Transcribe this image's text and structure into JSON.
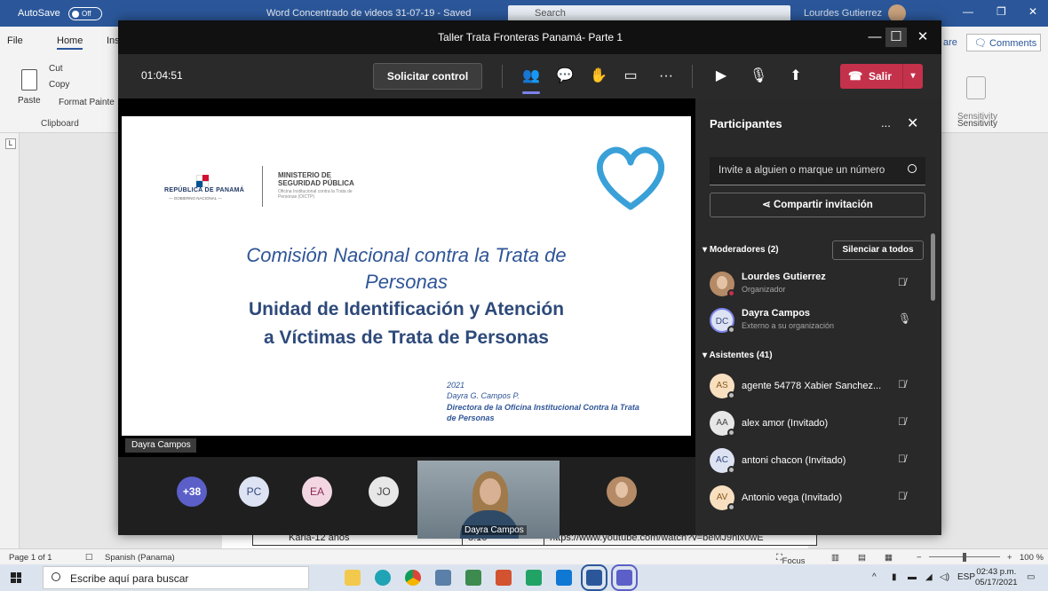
{
  "word": {
    "autosave_label": "AutoSave",
    "autosave_state": "Off",
    "doc_title": "Word Concentrado de videos 31-07-19 - Saved",
    "search_placeholder": "Search",
    "user_name": "Lourdes Gutierrez",
    "tabs": {
      "file": "File",
      "home": "Home",
      "insert_fragment": "Ins"
    },
    "clipboard": {
      "paste": "Paste",
      "cut": "Cut",
      "copy": "Copy",
      "format_painter": "Format Painte",
      "group": "Clipboard"
    },
    "share_fragment": "are",
    "comments": "Comments",
    "sensitivity": "Sensitivity",
    "sensitivity_group": "Sensitivity",
    "ruler_marker": "L",
    "table_row": {
      "col1": "Karla-12 años",
      "col2": "8:16",
      "col3": "https://www.youtube.com/watch?v=beMJ9hix0wE"
    },
    "status": {
      "page": "Page 1 of 1",
      "language": "Spanish (Panama)",
      "focus": "Focus",
      "zoom": "100 %"
    }
  },
  "taskbar": {
    "search_placeholder": "Escribe aquí para buscar",
    "lang": "ESP",
    "time": "02:43 p.m.",
    "date": "05/17/2021"
  },
  "teams": {
    "window_title": "Taller Trata Fronteras Panamá- Parte 1",
    "timer": "01:04:51",
    "request_control": "Solicitar control",
    "leave": "Salir",
    "presenter_name": "Dayra Campos",
    "slide": {
      "republica": "REPÚBLICA DE PANAMÁ",
      "republica_sub": "— GOBIERNO NACIONAL —",
      "ministerio_1": "MINISTERIO DE",
      "ministerio_2": "SEGURIDAD PÚBLICA",
      "ministerio_sub": "Oficina Institucional contra la Trata de Personas (OICTP)",
      "title_1": "Comisión Nacional contra la Trata de",
      "title_2": "Personas",
      "title_3": "Unidad de Identificación y Atención",
      "title_4": "a Víctimas de Trata de Personas",
      "year": "2021",
      "author": "Dayra G. Campos P.",
      "role_1": "Directora de la Oficina Institucional Contra la Trata",
      "role_2": "de Personas"
    },
    "gallery": {
      "overflow": "+38",
      "initials": [
        "PC",
        "EA",
        "JO"
      ],
      "speaker_name": "Dayra Campos"
    },
    "panel": {
      "title": "Participantes",
      "more": "...",
      "invite_placeholder": "Invite a alguien o marque un número",
      "share_invite": "Compartir invitación",
      "moderators_header": "Moderadores (2)",
      "mute_all": "Silenciar a todos",
      "attendees_header": "Asistentes (41)",
      "moderators": [
        {
          "name": "Lourdes Gutierrez",
          "role": "Organizador"
        },
        {
          "initials": "DC",
          "name": "Dayra Campos",
          "role": "Externo a su organización"
        }
      ],
      "attendees": [
        {
          "initials": "AS",
          "name": "agente 54778 Xabier Sanchez..."
        },
        {
          "initials": "AA",
          "name": "alex amor (Invitado)"
        },
        {
          "initials": "AC",
          "name": "antoni chacon (Invitado)"
        },
        {
          "initials": "AV",
          "name": "Antonio vega (Invitado)"
        }
      ]
    }
  },
  "colors": {
    "word_blue": "#2b579a",
    "teams_dark": "#1f1f1f",
    "leave_red": "#c4314b",
    "teams_accent": "#7b83eb",
    "heart_blue": "#3aa0d8"
  }
}
